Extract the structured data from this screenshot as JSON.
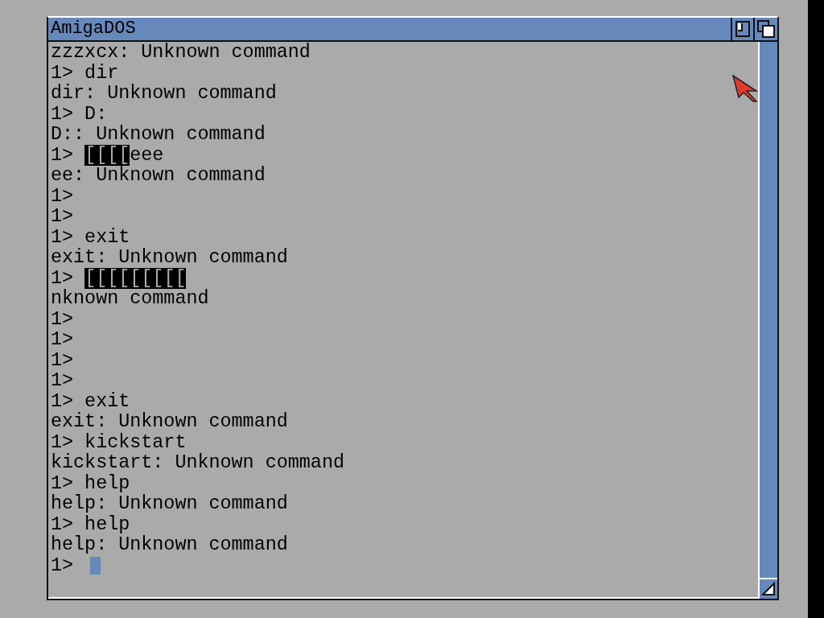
{
  "window": {
    "title": "AmigaDOS"
  },
  "lines": [
    {
      "text": "zzzxcx: Unknown command"
    },
    {
      "text": "1> dir"
    },
    {
      "text": "dir: Unknown command"
    },
    {
      "text": "1> D:"
    },
    {
      "text": "D:: Unknown command"
    },
    {
      "text": "1> ",
      "inverse": "[[[[",
      "after": "eee"
    },
    {
      "text": "ee: Unknown command"
    },
    {
      "text": "1>"
    },
    {
      "text": "1>"
    },
    {
      "text": "1> exit"
    },
    {
      "text": "exit: Unknown command"
    },
    {
      "text": "1> ",
      "inverse": "[[[[[[[[["
    },
    {
      "text": "nknown command"
    },
    {
      "text": "1>"
    },
    {
      "text": "1>"
    },
    {
      "text": "1>"
    },
    {
      "text": "1>"
    },
    {
      "text": "1> exit"
    },
    {
      "text": "exit: Unknown command"
    },
    {
      "text": "1> kickstart"
    },
    {
      "text": "kickstart: Unknown command"
    },
    {
      "text": "1> help"
    },
    {
      "text": "help: Unknown command"
    },
    {
      "text": "1> help"
    },
    {
      "text": "help: Unknown command"
    },
    {
      "text": "1> ",
      "cursor": true
    }
  ]
}
